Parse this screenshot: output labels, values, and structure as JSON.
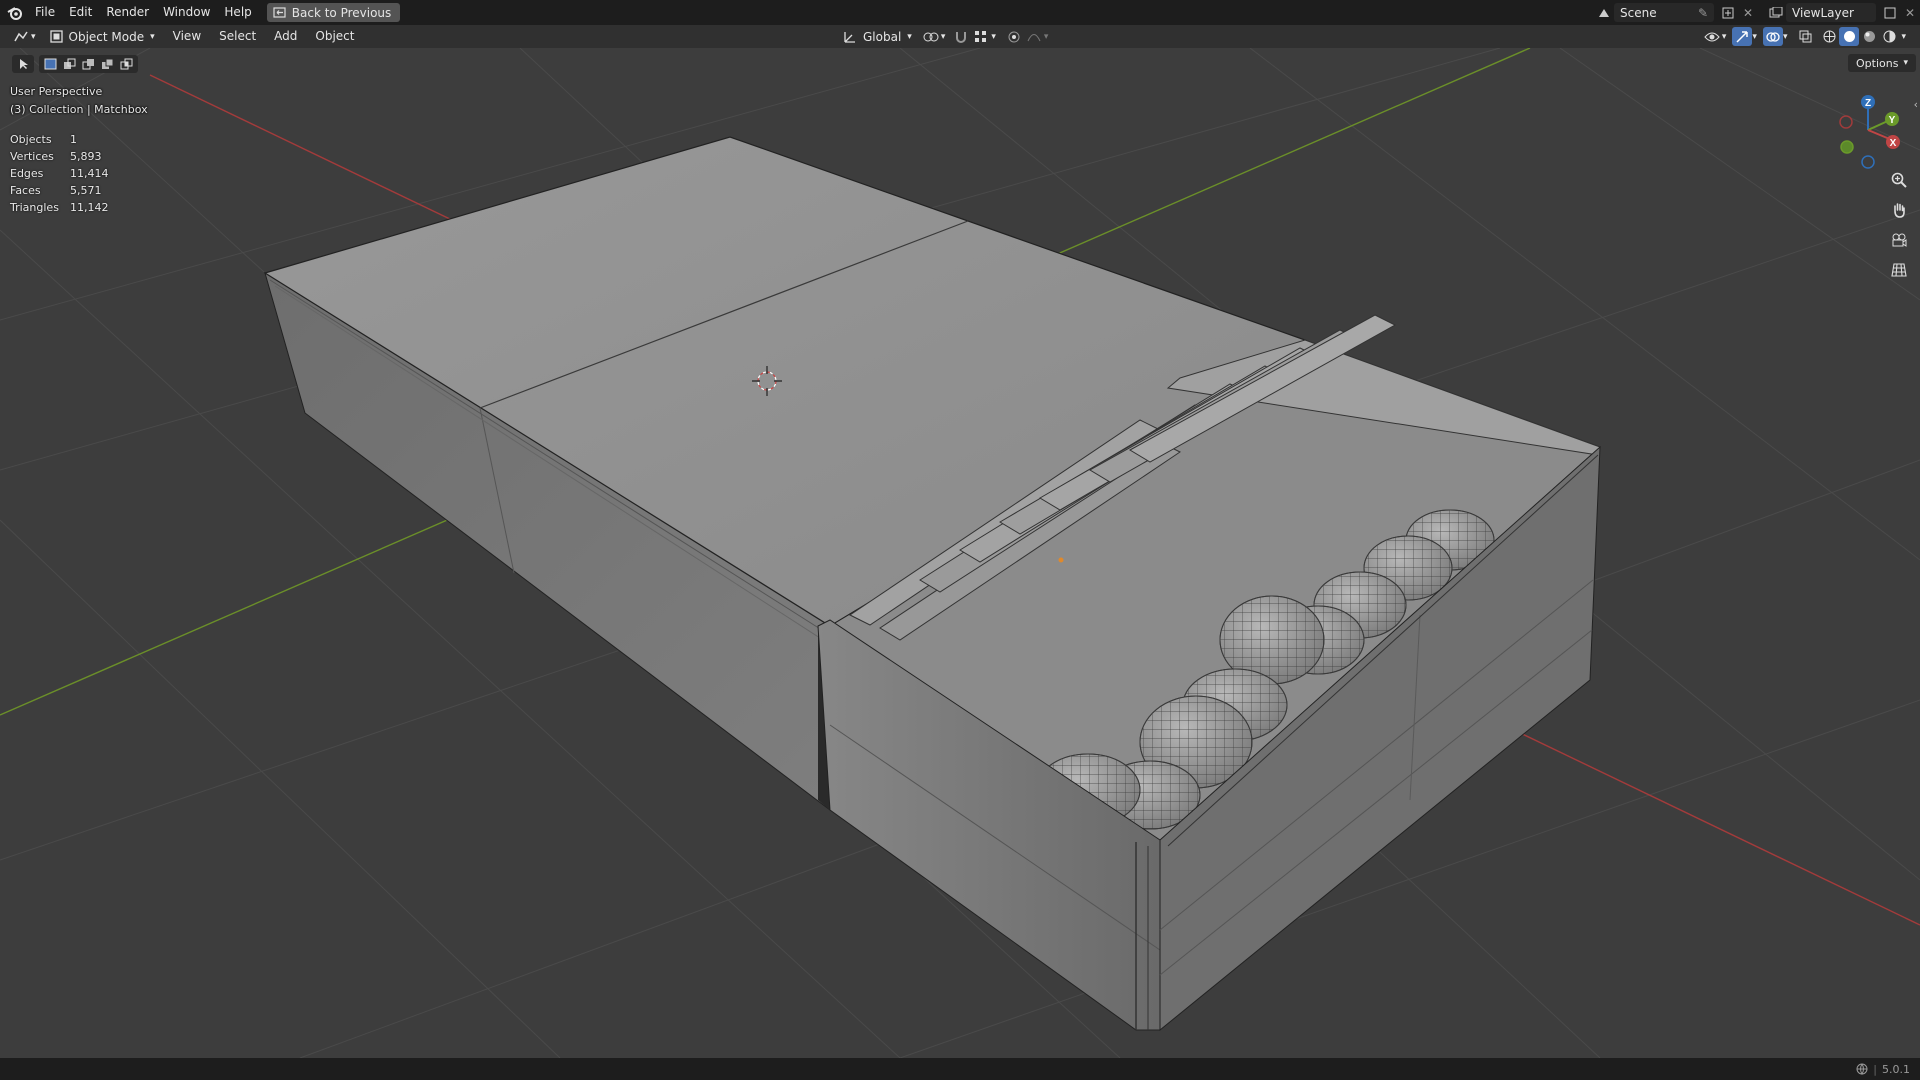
{
  "menu": {
    "file": "File",
    "edit": "Edit",
    "render": "Render",
    "window": "Window",
    "help": "Help",
    "back_to_previous": "Back to Previous"
  },
  "topbar_right": {
    "scene": "Scene",
    "view_layer": "ViewLayer"
  },
  "header": {
    "mode": "Object Mode",
    "view": "View",
    "select": "Select",
    "add": "Add",
    "object": "Object",
    "orientation": "Global",
    "options": "Options"
  },
  "viewport": {
    "perspective": "User Perspective",
    "collection": "(3) Collection | Matchbox"
  },
  "stats": [
    {
      "label": "Objects",
      "value": "1"
    },
    {
      "label": "Vertices",
      "value": "5,893"
    },
    {
      "label": "Edges",
      "value": "11,414"
    },
    {
      "label": "Faces",
      "value": "5,571"
    },
    {
      "label": "Triangles",
      "value": "11,142"
    }
  ],
  "gizmo": {
    "z": "Z",
    "y": "Y",
    "x": "X"
  },
  "status": {
    "version": "5.0.1"
  },
  "colors": {
    "x_axis": "#a33b3b",
    "y_axis": "#6b8f29",
    "accent": "#4772b3"
  }
}
